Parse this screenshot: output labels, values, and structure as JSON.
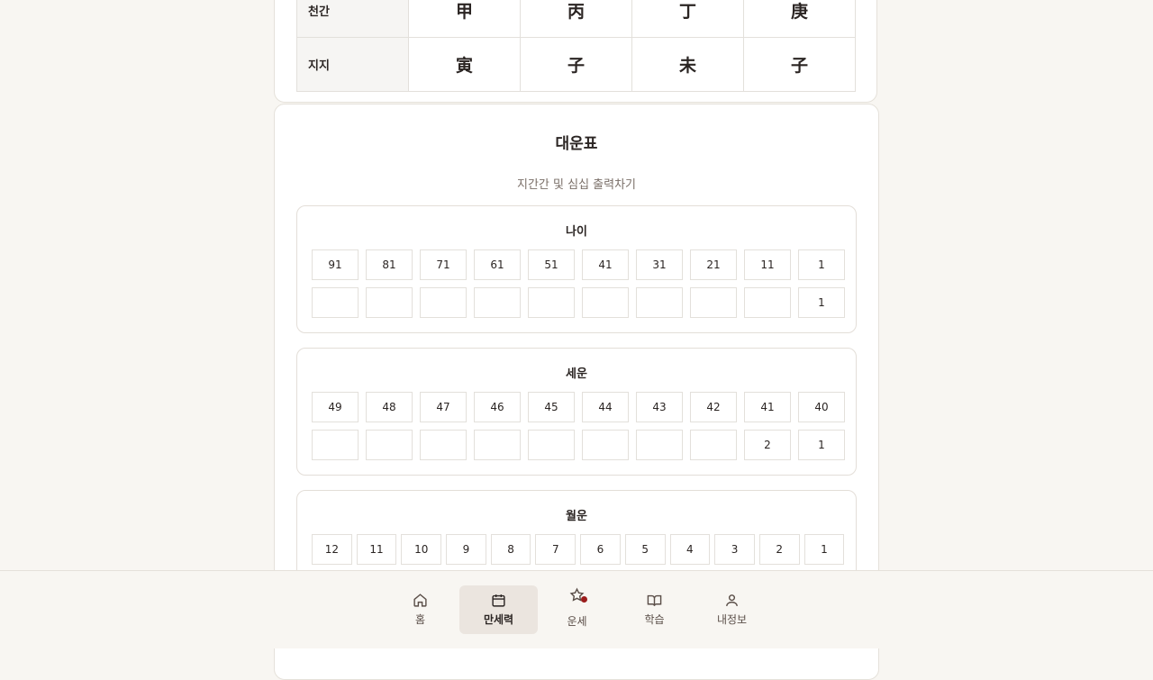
{
  "pillars": {
    "rows": [
      {
        "label": "천간",
        "cells": [
          "甲",
          "丙",
          "丁",
          "庚"
        ]
      },
      {
        "label": "지지",
        "cells": [
          "寅",
          "子",
          "未",
          "子"
        ]
      }
    ]
  },
  "card": {
    "title": "대운표",
    "subtitle": "지간간 및 심십 출력차기"
  },
  "daeun": {
    "label": "나이",
    "top": [
      "91",
      "81",
      "71",
      "61",
      "51",
      "41",
      "31",
      "21",
      "11",
      "1"
    ],
    "bottom": [
      "",
      "",
      "",
      "",
      "",
      "",
      "",
      "",
      "",
      "1"
    ]
  },
  "seun": {
    "label": "세운",
    "top": [
      "49",
      "48",
      "47",
      "46",
      "45",
      "44",
      "43",
      "42",
      "41",
      "40"
    ],
    "bottom": [
      "",
      "",
      "",
      "",
      "",
      "",
      "",
      "",
      "2",
      "1"
    ]
  },
  "wolun": {
    "label": "월운",
    "top": [
      "12",
      "11",
      "10",
      "9",
      "8",
      "7",
      "6",
      "5",
      "4",
      "3",
      "2",
      "1"
    ]
  },
  "nav": {
    "items": [
      {
        "label": "홈",
        "icon": "home-icon",
        "active": false
      },
      {
        "label": "만세력",
        "icon": "calendar-icon",
        "active": true
      },
      {
        "label": "운세",
        "icon": "star-icon",
        "active": false,
        "badge": true
      },
      {
        "label": "학습",
        "icon": "book-icon",
        "active": false
      },
      {
        "label": "내정보",
        "icon": "user-icon",
        "active": false
      }
    ],
    "accent": "#9b1c1c"
  }
}
